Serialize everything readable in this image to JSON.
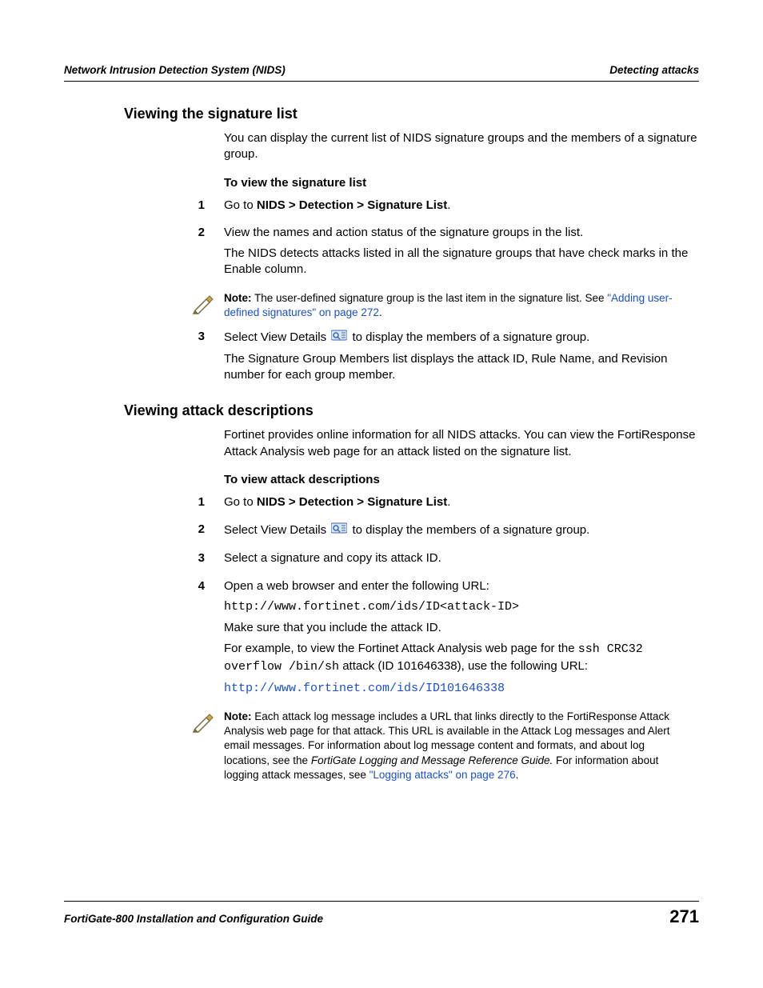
{
  "header": {
    "left": "Network Intrusion Detection System (NIDS)",
    "right": "Detecting attacks"
  },
  "section1": {
    "title": "Viewing the signature list",
    "intro": "You can display the current list of NIDS signature groups and the members of a signature group.",
    "subhead": "To view the signature list",
    "step1_num": "1",
    "step1_prefix": "Go to ",
    "step1_path": "NIDS > Detection > Signature List",
    "step1_suffix": ".",
    "step2_num": "2",
    "step2_line1": "View the names and action status of the signature groups in the list.",
    "step2_line2": "The NIDS detects attacks listed in all the signature groups that have check marks in the Enable column.",
    "note_label": "Note:",
    "note_text": " The user-defined signature group is the last item in the signature list. See ",
    "note_link": "\"Adding user-defined signatures\" on page 272",
    "note_suffix": ".",
    "step3_num": "3",
    "step3_a": "Select View Details ",
    "step3_b": " to display the members of a signature group.",
    "step3_line2": "The Signature Group Members list displays the attack ID, Rule Name, and Revision number for each group member."
  },
  "section2": {
    "title": "Viewing attack descriptions",
    "intro": "Fortinet provides online information for all NIDS attacks. You can view the FortiResponse Attack Analysis web page for an attack listed on the signature list.",
    "subhead": "To view attack descriptions",
    "step1_num": "1",
    "step1_prefix": "Go to ",
    "step1_path": "NIDS > Detection > Signature List",
    "step1_suffix": ".",
    "step2_num": "2",
    "step2_a": "Select View Details ",
    "step2_b": " to display the members of a signature group.",
    "step3_num": "3",
    "step3_text": "Select a signature and copy its attack ID.",
    "step4_num": "4",
    "step4_line1": "Open a web browser and enter the following URL:",
    "step4_url1": "http://www.fortinet.com/ids/ID<attack-ID>",
    "step4_line2": "Make sure that you include the attack ID.",
    "step4_line3a": "For example, to view the Fortinet Attack Analysis web page for the ",
    "step4_mono1": "ssh CRC32 overflow /bin/sh",
    "step4_line3b": " attack (ID 101646338), use the following URL:",
    "step4_url2": "http://www.fortinet.com/ids/ID101646338",
    "note_label": "Note:",
    "note_text1": " Each attack log message includes a URL that links directly to the FortiResponse Attack Analysis web page for that attack. This URL is available in the Attack Log messages and Alert email messages. For information about log message content and formats, and about log locations, see the ",
    "note_italic": "FortiGate Logging and Message Reference Guide.",
    "note_text2": " For information about logging attack messages, see ",
    "note_link": "\"Logging attacks\" on page 276",
    "note_suffix": "."
  },
  "footer": {
    "title": "FortiGate-800 Installation and Configuration Guide",
    "page": "271"
  }
}
